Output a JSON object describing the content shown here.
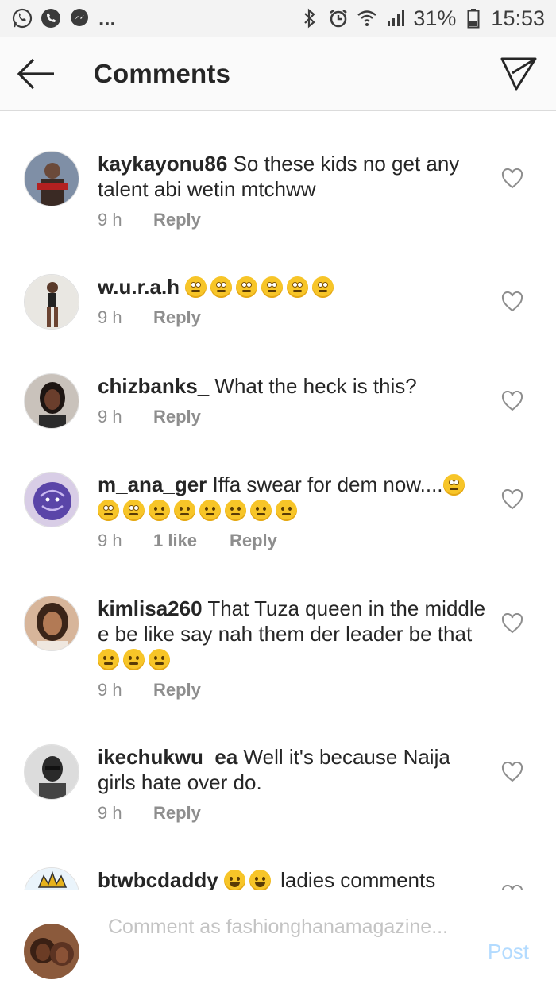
{
  "status_bar": {
    "left_icons": [
      "whatsapp-icon",
      "phone-icon",
      "messenger-icon"
    ],
    "dots": "...",
    "right_icons": [
      "bluetooth-icon",
      "alarm-icon",
      "wifi-icon",
      "signal-icon",
      "battery-icon"
    ],
    "battery": "31%",
    "time": "15:53"
  },
  "header": {
    "title": "Comments",
    "back_icon": "arrow-left-icon",
    "share_icon": "send-icon"
  },
  "comments": [
    {
      "username": "kaykayonu86",
      "text": "So these kids no get any talent abi wetin mtchww",
      "emojis": [],
      "time": "9 h",
      "likes": "",
      "reply": "Reply"
    },
    {
      "username": "w.u.r.a.h",
      "text": "",
      "emojis": [
        "eye-roll",
        "eye-roll",
        "eye-roll",
        "eye-roll",
        "eye-roll",
        "eye-roll"
      ],
      "time": "9 h",
      "likes": "",
      "reply": "Reply"
    },
    {
      "username": "chizbanks_",
      "text": "What the heck is this?",
      "emojis": [],
      "time": "9 h",
      "likes": "",
      "reply": "Reply"
    },
    {
      "username": "m_ana_ger",
      "text": "Iffa swear for dem now....",
      "emojis": [
        "eye-roll",
        "eye-roll",
        "eye-roll",
        "smirk",
        "smirk",
        "smirk",
        "unamused",
        "unamused",
        "unamused"
      ],
      "time": "9 h",
      "likes": "1 like",
      "reply": "Reply"
    },
    {
      "username": "kimlisa260",
      "text": "That Tuza queen in the middle e be like say nah them der leader be that",
      "emojis": [
        "confused",
        "confused",
        "confused"
      ],
      "time": "9 h",
      "likes": "",
      "reply": "Reply"
    },
    {
      "username": "ikechukwu_ea",
      "text": "Well it's because Naija girls hate over do.",
      "emojis": [],
      "time": "9 h",
      "likes": "",
      "reply": "Reply"
    },
    {
      "username": "btwbcdaddy",
      "text": "ladies comments",
      "emojis_before": [
        "joy",
        "joy"
      ],
      "time": "",
      "likes": "",
      "reply": ""
    }
  ],
  "composer": {
    "placeholder": "Comment as fashionghanamagazine...",
    "post_label": "Post"
  },
  "colors": {
    "status_bg": "#f3f3f3",
    "header_bg": "#fafafa",
    "text": "#262626",
    "meta": "#8e8e8e",
    "post_disabled": "#b3dbff"
  }
}
